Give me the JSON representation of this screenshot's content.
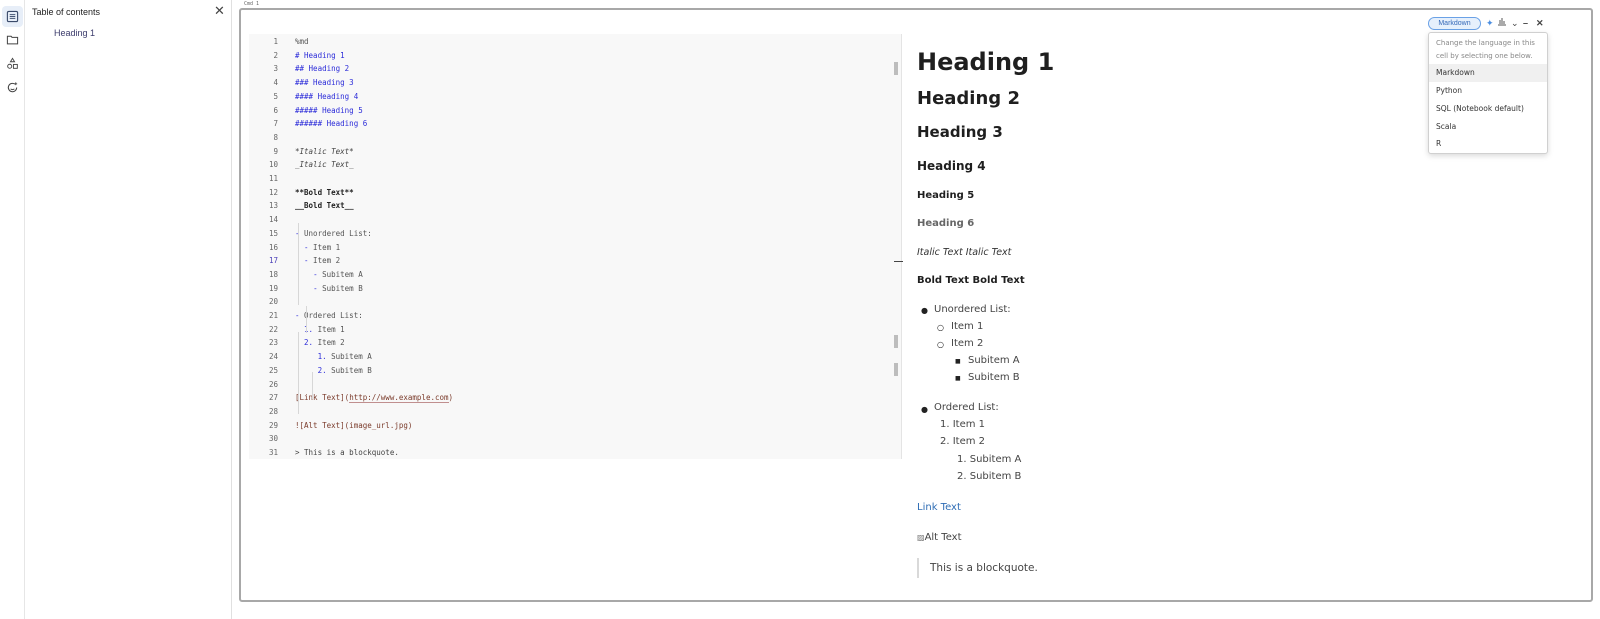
{
  "rail": {
    "items": [
      {
        "icon": "table-of-contents-icon",
        "active": true
      },
      {
        "icon": "folder-icon",
        "active": false
      },
      {
        "icon": "shapes-icon",
        "active": false
      },
      {
        "icon": "history-icon",
        "active": false
      }
    ]
  },
  "toc": {
    "title": "Table of contents",
    "close_icon": "close-icon",
    "items": [
      "Heading 1"
    ]
  },
  "cell": {
    "label": "Cmd 1",
    "language": "Markdown",
    "toolbar_icons": [
      "sparkle-icon",
      "chart-icon",
      "chevron-down-icon",
      "minimize-icon",
      "close-icon"
    ]
  },
  "editor": {
    "lines": [
      {
        "n": "1",
        "text": "%md"
      },
      {
        "n": "2",
        "text": "# Heading 1"
      },
      {
        "n": "3",
        "text": "## Heading 2"
      },
      {
        "n": "4",
        "text": "### Heading 3"
      },
      {
        "n": "5",
        "text": "#### Heading 4"
      },
      {
        "n": "6",
        "text": "##### Heading 5"
      },
      {
        "n": "7",
        "text": "###### Heading 6"
      },
      {
        "n": "8",
        "text": ""
      },
      {
        "n": "9",
        "text": "*Italic Text*"
      },
      {
        "n": "10",
        "text": "_Italic Text_"
      },
      {
        "n": "11",
        "text": ""
      },
      {
        "n": "12",
        "text": "**Bold Text**"
      },
      {
        "n": "13",
        "text": "__Bold Text__"
      },
      {
        "n": "14",
        "text": ""
      },
      {
        "n": "15",
        "text": "- Unordered List:"
      },
      {
        "n": "16",
        "text": "  - Item 1"
      },
      {
        "n": "17",
        "text": "  - Item 2"
      },
      {
        "n": "18",
        "text": "    - Subitem A"
      },
      {
        "n": "19",
        "text": "    - Subitem B"
      },
      {
        "n": "20",
        "text": ""
      },
      {
        "n": "21",
        "text": "- Ordered List:"
      },
      {
        "n": "22",
        "text": "  1. Item 1"
      },
      {
        "n": "23",
        "text": "  2. Item 2"
      },
      {
        "n": "24",
        "text": "     1. Subitem A"
      },
      {
        "n": "25",
        "text": "     2. Subitem B"
      },
      {
        "n": "26",
        "text": ""
      },
      {
        "n": "27",
        "text": "[Link Text](http://www.example.com)"
      },
      {
        "n": "28",
        "text": ""
      },
      {
        "n": "29",
        "text": "![Alt Text](image_url.jpg)"
      },
      {
        "n": "30",
        "text": ""
      },
      {
        "n": "31",
        "text": "> This is a blockquote."
      }
    ],
    "current_line": "17"
  },
  "preview": {
    "h1": "Heading 1",
    "h2": "Heading 2",
    "h3": "Heading 3",
    "h4": "Heading 4",
    "h5": "Heading 5",
    "h6": "Heading 6",
    "italic": "Italic Text Italic Text",
    "bold": "Bold Text Bold Text",
    "unordered_label": "Unordered List:",
    "unordered_items": [
      "Item 1",
      "Item 2"
    ],
    "unordered_subitems": [
      "Subitem A",
      "Subitem B"
    ],
    "ordered_label": "Ordered List:",
    "ordered_items": [
      "1. Item 1",
      "2. Item 2"
    ],
    "ordered_subitems": [
      "1. Subitem A",
      "2. Subitem B"
    ],
    "link": "Link Text",
    "image_alt": "Alt Text",
    "blockquote": "This is a blockquote."
  },
  "language_menu": {
    "hint": "Change the language in this cell by selecting one below.",
    "options": [
      "Markdown",
      "Python",
      "SQL (Notebook default)",
      "Scala",
      "R"
    ],
    "selected": "Markdown"
  },
  "colors": {
    "accent": "#3569b8",
    "link": "#2f6db5"
  }
}
